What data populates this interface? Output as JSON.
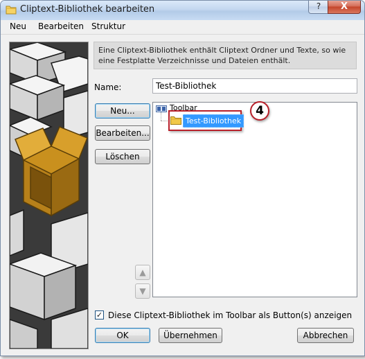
{
  "window": {
    "title": "Cliptext-Bibliothek bearbeiten",
    "help_label": "?",
    "close_label": "X"
  },
  "menu": {
    "items": [
      {
        "label": "Neu"
      },
      {
        "label": "Bearbeiten"
      },
      {
        "label": "Struktur"
      }
    ]
  },
  "info": {
    "text": "Eine Cliptext-Bibliothek enthält Cliptext Ordner und Texte, so wie eine Festplatte Verzeichnisse und Dateien enthält."
  },
  "form": {
    "name_label": "Name:",
    "name_value": "Test-Bibliothek"
  },
  "buttons": {
    "new": "Neu...",
    "edit": "Bearbeiten...",
    "delete": "Löschen",
    "ok": "OK",
    "apply": "Übernehmen",
    "cancel": "Abbrechen",
    "up_icon": "▲",
    "down_icon": "▼"
  },
  "tree": {
    "root_label": "Toolbar",
    "selected_label": "Test-Bibliothek"
  },
  "annotation": {
    "step_number": "4",
    "accent_color": "#b8202a"
  },
  "checkbox": {
    "checked": true,
    "mark": "✓",
    "label": "Diese Cliptext-Bibliothek im Toolbar als Button(s) anzeigen"
  },
  "colors": {
    "selection": "#3399ff",
    "folder": "#f1c94a"
  }
}
